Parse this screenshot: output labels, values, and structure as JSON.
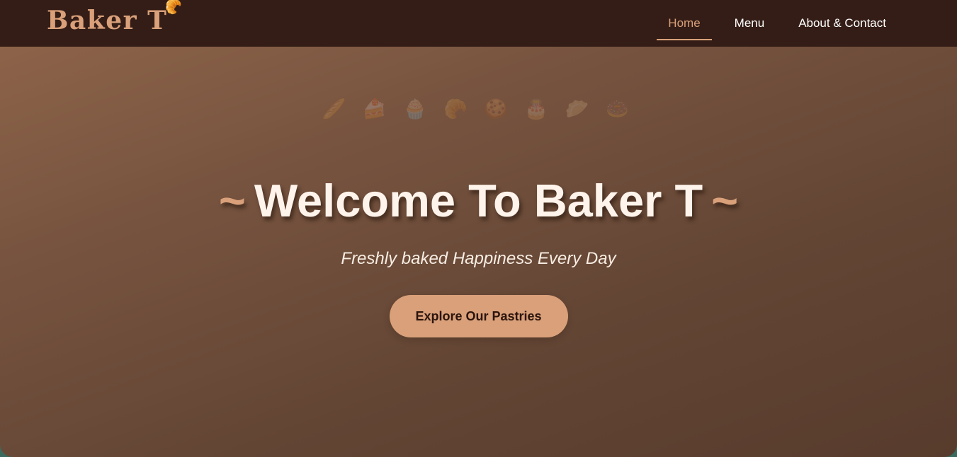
{
  "header": {
    "brand": "Baker T",
    "brand_icon": "🥐",
    "nav": [
      {
        "label": "Home",
        "active": true
      },
      {
        "label": "Menu",
        "active": false
      },
      {
        "label": "About & Contact",
        "active": false
      }
    ]
  },
  "hero": {
    "pastries": [
      "🥖",
      "🍰",
      "🧁",
      "🥐",
      "🍪",
      "🎂",
      "🥟",
      "🍩"
    ],
    "title_prefix": "~",
    "title": "Welcome To Baker T",
    "title_suffix": "~",
    "subtitle": "Freshly baked Happiness Every Day",
    "cta_label": "Explore Our Pastries"
  },
  "colors": {
    "nav_background": "#341d16",
    "accent": "#d9a07a",
    "hero_gradient_start": "#8d6349",
    "hero_gradient_end": "#573b2c",
    "page_background": "#3a6b5e"
  }
}
